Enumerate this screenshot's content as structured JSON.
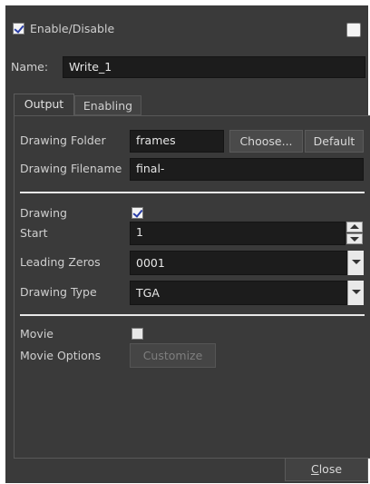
{
  "header": {
    "enable_label": "Enable/Disable",
    "enable_checked": true,
    "right_checkbox_checked": false
  },
  "name_row": {
    "label": "Name:",
    "value": "Write_1"
  },
  "tabs": [
    {
      "label": "Output",
      "active": true
    },
    {
      "label": "Enabling",
      "active": false
    }
  ],
  "output": {
    "drawing_folder_label": "Drawing Folder",
    "drawing_folder_value": "frames",
    "choose_label": "Choose...",
    "default_label": "Default",
    "drawing_filename_label": "Drawing Filename",
    "drawing_filename_value": "final-",
    "drawing_label": "Drawing",
    "drawing_checked": true,
    "start_label": "Start",
    "start_value": "1",
    "leading_zeros_label": "Leading Zeros",
    "leading_zeros_value": "0001",
    "drawing_type_label": "Drawing Type",
    "drawing_type_value": "TGA",
    "movie_label": "Movie",
    "movie_checked": false,
    "movie_options_label": "Movie Options",
    "customize_label": "Customize"
  },
  "footer": {
    "close_mnemonic": "C",
    "close_rest": "lose"
  },
  "colors": {
    "window_bg": "#3a3a3a",
    "field_bg": "#1c1c1c",
    "check_mark": "#2a3ea8"
  }
}
